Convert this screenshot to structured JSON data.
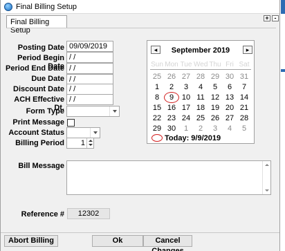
{
  "window": {
    "title": "Final Billing Setup"
  },
  "tab": {
    "label": "Final Billing Setup"
  },
  "corner_buttons": {
    "plus": "+",
    "minus": "-"
  },
  "form": {
    "posting_date": {
      "label": "Posting Date",
      "value": "09/09/2019"
    },
    "period_begin_date": {
      "label": "Period Begin Date",
      "value": " / /"
    },
    "period_end_date": {
      "label": "Period End Date",
      "value": " / /"
    },
    "due_date": {
      "label": "Due Date",
      "value": " / /"
    },
    "discount_date": {
      "label": "Discount Date",
      "value": " / /"
    },
    "ach_effective_date": {
      "label": "ACH Effective Dt.",
      "value": " / /"
    },
    "form_type": {
      "label": "Form Type",
      "value": ""
    },
    "print_message": {
      "label": "Print Message",
      "checked": false
    },
    "account_status": {
      "label": "Account Status",
      "value": ""
    },
    "billing_period": {
      "label": "Billing Period",
      "value": "1"
    },
    "bill_message": {
      "label": "Bill Message",
      "value": ""
    },
    "reference": {
      "label": "Reference #",
      "value": "12302"
    }
  },
  "calendar": {
    "prev": "◂",
    "next": "▸",
    "title": "September 2019",
    "weekdays": [
      "Sun",
      "Mon",
      "Tue",
      "Wed",
      "Thu",
      "Fri",
      "Sat"
    ],
    "weeks": [
      [
        {
          "d": "25",
          "o": true
        },
        {
          "d": "26",
          "o": true
        },
        {
          "d": "27",
          "o": true
        },
        {
          "d": "28",
          "o": true
        },
        {
          "d": "29",
          "o": true
        },
        {
          "d": "30",
          "o": true
        },
        {
          "d": "31",
          "o": true
        }
      ],
      [
        {
          "d": "1"
        },
        {
          "d": "2"
        },
        {
          "d": "3"
        },
        {
          "d": "4"
        },
        {
          "d": "5"
        },
        {
          "d": "6"
        },
        {
          "d": "7"
        }
      ],
      [
        {
          "d": "8"
        },
        {
          "d": "9",
          "today": true
        },
        {
          "d": "10"
        },
        {
          "d": "11"
        },
        {
          "d": "12"
        },
        {
          "d": "13"
        },
        {
          "d": "14"
        }
      ],
      [
        {
          "d": "15"
        },
        {
          "d": "16"
        },
        {
          "d": "17"
        },
        {
          "d": "18"
        },
        {
          "d": "19"
        },
        {
          "d": "20"
        },
        {
          "d": "21"
        }
      ],
      [
        {
          "d": "22"
        },
        {
          "d": "23"
        },
        {
          "d": "24"
        },
        {
          "d": "25"
        },
        {
          "d": "26"
        },
        {
          "d": "27"
        },
        {
          "d": "28"
        }
      ],
      [
        {
          "d": "29"
        },
        {
          "d": "30"
        },
        {
          "d": "1",
          "o": true
        },
        {
          "d": "2",
          "o": true
        },
        {
          "d": "3",
          "o": true
        },
        {
          "d": "4",
          "o": true
        },
        {
          "d": "5",
          "o": true
        }
      ]
    ],
    "today_text": "Today: 9/9/2019",
    "today_color": "#d21e1e"
  },
  "buttons": {
    "abort_billing": "Abort Billing",
    "ok": "Ok",
    "cancel_changes": "Cancel Changes"
  }
}
